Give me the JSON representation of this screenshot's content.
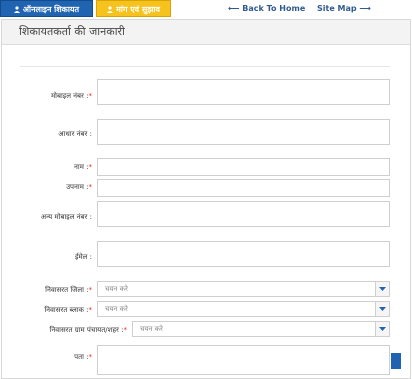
{
  "topbar": {
    "tab_online": "ऑनलाइन शिकायत",
    "tab_demand": "मांग एवं सुझाव",
    "back_home": "Back To Home",
    "site_map": "Site Map"
  },
  "panel": {
    "title": "शिकायतकर्ता की जानकारी"
  },
  "form": {
    "mobile_label": "मोबाइल नंबर :",
    "aadhar_label": "आधार नंबर :",
    "name_label": "नाम :",
    "surname_label": "उपनाम :",
    "alt_mobile_label": "अन्य मोबाइल नंबर :",
    "email_label": "ईमेल :",
    "district_label": "निवासरत जिला :",
    "block_label": "निवासरत ब्लाक :",
    "panchayat_label": "निवासरत ग्राम पंचायत/शहर :",
    "address_label": "पता :",
    "select_placeholder": "चयन करे",
    "required_mark": "*"
  },
  "colors": {
    "primary_blue": "#1f63b1",
    "accent_yellow": "#f6c21c",
    "required_red": "#e0261b"
  }
}
